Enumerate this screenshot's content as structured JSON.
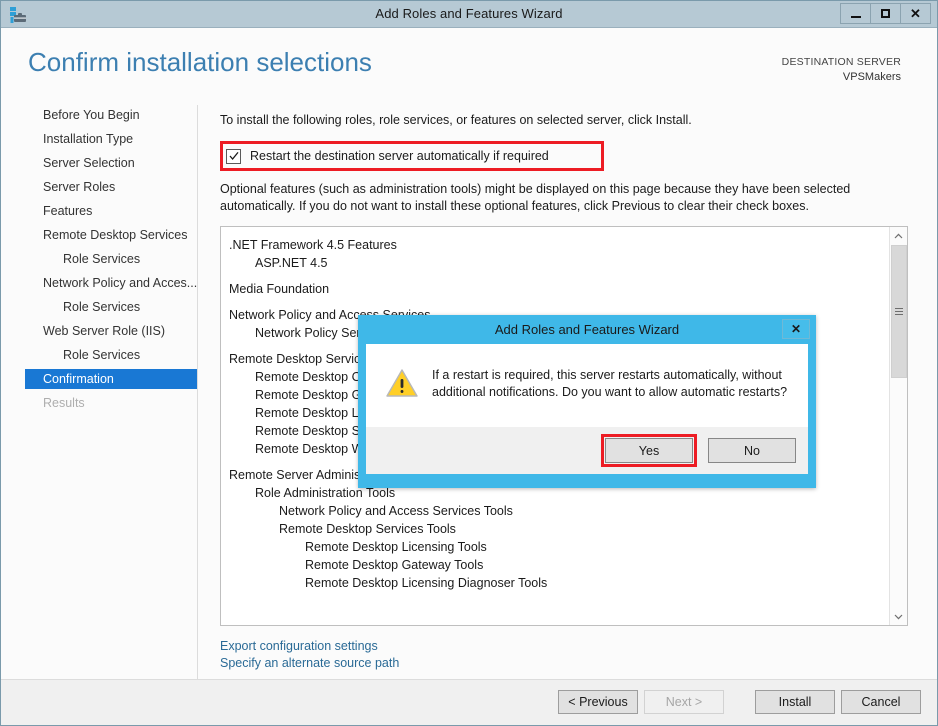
{
  "window": {
    "title": "Add Roles and Features Wizard",
    "icon": "server-wizard-icon",
    "buttons": {
      "minimize": "minimize-button",
      "maximize": "maximize-button",
      "close": "✕"
    }
  },
  "header": {
    "page_title": "Confirm installation selections",
    "destination_label": "DESTINATION SERVER",
    "destination_value": "VPSMakers"
  },
  "sidebar": {
    "items": [
      {
        "label": "Before You Begin",
        "level": 0,
        "state": "normal"
      },
      {
        "label": "Installation Type",
        "level": 0,
        "state": "normal"
      },
      {
        "label": "Server Selection",
        "level": 0,
        "state": "normal"
      },
      {
        "label": "Server Roles",
        "level": 0,
        "state": "normal"
      },
      {
        "label": "Features",
        "level": 0,
        "state": "normal"
      },
      {
        "label": "Remote Desktop Services",
        "level": 0,
        "state": "normal"
      },
      {
        "label": "Role Services",
        "level": 1,
        "state": "normal"
      },
      {
        "label": "Network Policy and Acces...",
        "level": 0,
        "state": "normal"
      },
      {
        "label": "Role Services",
        "level": 1,
        "state": "normal"
      },
      {
        "label": "Web Server Role (IIS)",
        "level": 0,
        "state": "normal"
      },
      {
        "label": "Role Services",
        "level": 1,
        "state": "normal"
      },
      {
        "label": "Confirmation",
        "level": 0,
        "state": "selected"
      },
      {
        "label": "Results",
        "level": 0,
        "state": "disabled"
      }
    ]
  },
  "main": {
    "intro": "To install the following roles, role services, or features on selected server, click Install.",
    "restart_checkbox": {
      "label": "Restart the destination server automatically if required",
      "checked": true,
      "highlighted": true
    },
    "optional_note": "Optional features (such as administration tools) might be displayed on this page because they have been selected automatically. If you do not want to install these optional features, click Previous to clear their check boxes.",
    "feature_list": [
      {
        "label": ".NET Framework 4.5 Features",
        "level": 0,
        "gap": false
      },
      {
        "label": "ASP.NET 4.5",
        "level": 1,
        "gap": false
      },
      {
        "label": "Media Foundation",
        "level": 0,
        "gap": true
      },
      {
        "label": "Network Policy and Access Services",
        "level": 0,
        "gap": true
      },
      {
        "label": "Network Policy Server",
        "level": 1,
        "gap": false
      },
      {
        "label": "Remote Desktop Services",
        "level": 0,
        "gap": true
      },
      {
        "label": "Remote Desktop Connection Broker",
        "level": 1,
        "gap": false
      },
      {
        "label": "Remote Desktop Gateway",
        "level": 1,
        "gap": false
      },
      {
        "label": "Remote Desktop Licensing",
        "level": 1,
        "gap": false
      },
      {
        "label": "Remote Desktop Session Host",
        "level": 1,
        "gap": false
      },
      {
        "label": "Remote Desktop Web Access",
        "level": 1,
        "gap": false
      },
      {
        "label": "Remote Server Administration Tools",
        "level": 0,
        "gap": true
      },
      {
        "label": "Role Administration Tools",
        "level": 1,
        "gap": false
      },
      {
        "label": "Network Policy and Access Services Tools",
        "level": 2,
        "gap": false
      },
      {
        "label": "Remote Desktop Services Tools",
        "level": 2,
        "gap": false
      },
      {
        "label": "Remote Desktop Licensing Tools",
        "level": 3,
        "gap": false
      },
      {
        "label": "Remote Desktop Gateway Tools",
        "level": 3,
        "gap": false
      },
      {
        "label": "Remote Desktop Licensing Diagnoser Tools",
        "level": 3,
        "gap": false
      }
    ],
    "scrollbar": {
      "up_arrow": "⌃",
      "down_arrow": "⌄"
    },
    "links": [
      "Export configuration settings",
      "Specify an alternate source path"
    ]
  },
  "footer": {
    "previous": "< Previous",
    "next": "Next >",
    "install": "Install",
    "cancel": "Cancel",
    "next_disabled": true
  },
  "dialog": {
    "title": "Add Roles and Features Wizard",
    "close": "✕",
    "icon": "warning-icon",
    "message": "If a restart is required, this server restarts automatically, without additional notifications. Do you want to allow automatic restarts?",
    "yes": "Yes",
    "no": "No",
    "yes_highlighted": true
  },
  "colors": {
    "titlebar": "#b6c9d4",
    "accent_title": "#3c7fb1",
    "selected_nav": "#1978d4",
    "dialog_frame": "#3fb8e8",
    "highlight_red": "#ed1c24",
    "link": "#2a6a96"
  }
}
